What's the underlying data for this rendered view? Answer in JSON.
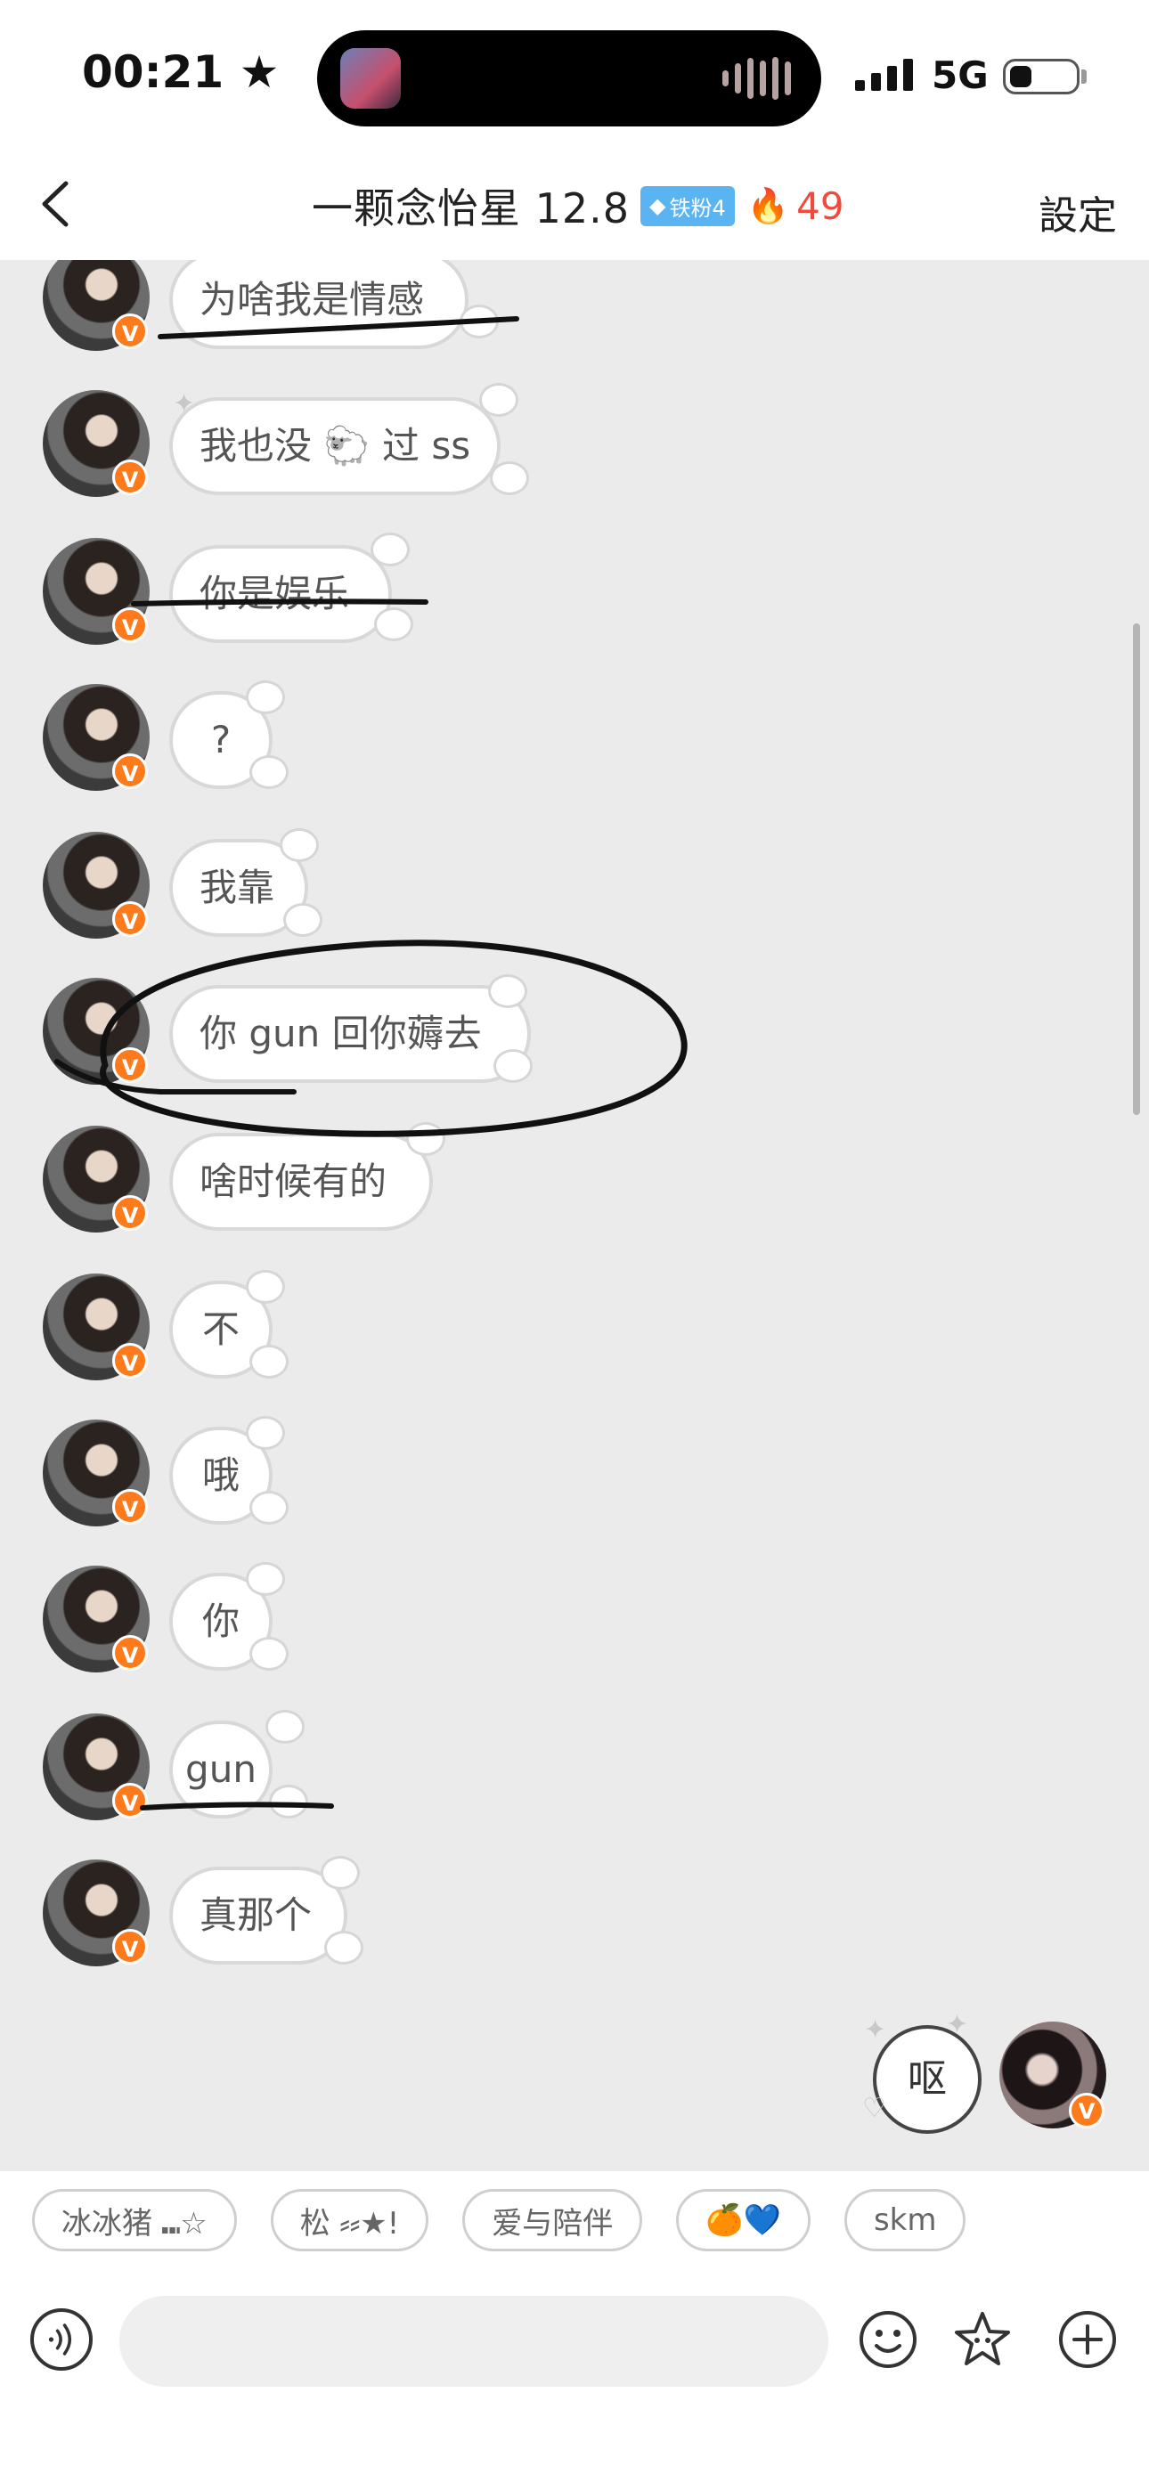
{
  "status": {
    "time": "00:21",
    "time_star": "★",
    "network": "5G"
  },
  "header": {
    "title": "一颗念怡星 12.8",
    "fan_badge": "铁粉4",
    "streak": "49",
    "settings": "設定"
  },
  "messages": [
    {
      "text": "为啥我是情感",
      "emoji": ""
    },
    {
      "text": "我也没",
      "emoji": "🐑",
      "text2": "过 ss"
    },
    {
      "text": "你是娱乐"
    },
    {
      "text": "?"
    },
    {
      "text": "我靠"
    },
    {
      "text": "你 gun 回你薅去"
    },
    {
      "text": "啥时候有的"
    },
    {
      "text": "不"
    },
    {
      "text": "哦"
    },
    {
      "text": "你"
    },
    {
      "text": "gun"
    },
    {
      "text": "真那个"
    }
  ],
  "outgoing": {
    "text": "呕"
  },
  "quick_replies": [
    "冰冰猪 ⑉☆",
    "松 ⸗⸗★!",
    "爱与陪伴",
    "🍊💙",
    "skm"
  ],
  "colors": {
    "accent_orange": "#ff7a1a",
    "streak_red": "#f04a3c",
    "badge_blue": "#5ab4f2",
    "background": "#ebebeb"
  },
  "icons": [
    "back-icon",
    "voice-icon",
    "emoji-icon",
    "star-sticker-icon",
    "plus-icon",
    "verified-badge-icon",
    "fire-icon"
  ]
}
